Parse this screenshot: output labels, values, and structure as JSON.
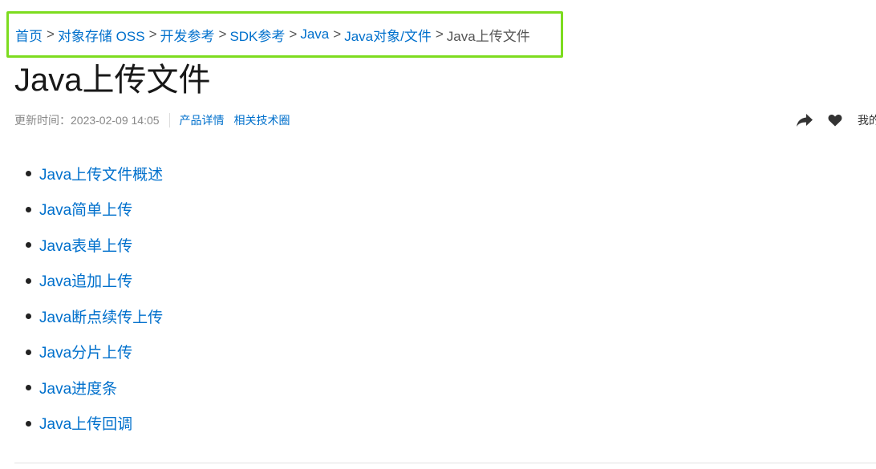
{
  "breadcrumb": {
    "items": [
      {
        "label": "首页"
      },
      {
        "label": "对象存储 OSS"
      },
      {
        "label": "开发参考"
      },
      {
        "label": "SDK参考"
      },
      {
        "label": "Java"
      },
      {
        "label": "Java对象/文件"
      }
    ],
    "separator": ">",
    "current": "Java上传文件"
  },
  "title": "Java上传文件",
  "meta": {
    "updated": "更新时间：2023-02-09 14:05",
    "links": [
      "产品详情",
      "相关技术圈"
    ],
    "my_label": "我的"
  },
  "icons": {
    "share": "share-icon",
    "favorite": "heart-icon"
  },
  "toc": [
    {
      "label": "Java上传文件概述"
    },
    {
      "label": "Java简单上传"
    },
    {
      "label": "Java表单上传"
    },
    {
      "label": "Java追加上传"
    },
    {
      "label": "Java断点续传上传"
    },
    {
      "label": "Java分片上传"
    },
    {
      "label": "Java进度条"
    },
    {
      "label": "Java上传回调"
    }
  ],
  "colors": {
    "link": "#0070cc",
    "highlight_border": "#7ddc1f",
    "icon": "#333333"
  }
}
